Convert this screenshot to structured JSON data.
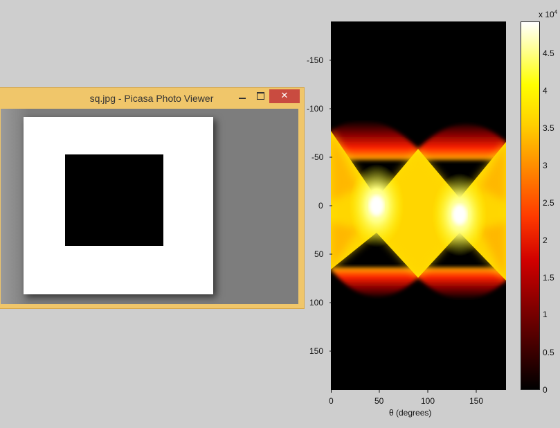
{
  "window": {
    "title": "sq.jpg - Picasa Photo Viewer",
    "minimize_icon": "minimize-icon",
    "maximize_icon": "maximize-icon",
    "close_glyph": "✕"
  },
  "figure": {
    "yticks": [
      "-150",
      "-100",
      "-50",
      "0",
      "50",
      "100",
      "150"
    ],
    "xticks": [
      "0",
      "50",
      "100",
      "150"
    ],
    "xlabel": "θ (degrees)",
    "colorbar": {
      "ticks": [
        "0",
        "0.5",
        "1",
        "1.5",
        "2",
        "2.5",
        "3",
        "3.5",
        "4",
        "4.5"
      ],
      "exponent_prefix": "x 10",
      "exponent_power": "4",
      "colormap": "hot"
    }
  }
}
